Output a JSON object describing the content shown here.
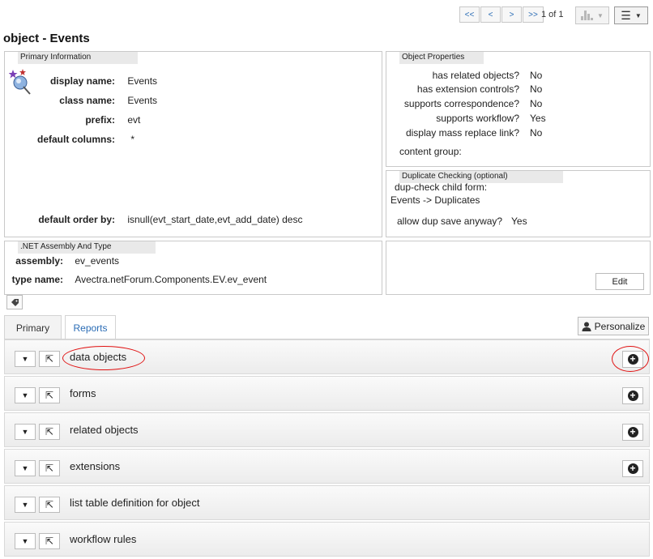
{
  "pager": {
    "first": "<<",
    "prev": "<",
    "next": ">",
    "last": ">>",
    "count": "1 of 1"
  },
  "page_title": "object - Events",
  "primary_info": {
    "title": "Primary Information",
    "rows": [
      {
        "label": "display name:",
        "value": "Events"
      },
      {
        "label": "class name:",
        "value": "Events"
      },
      {
        "label": "prefix:",
        "value": "evt"
      },
      {
        "label": "default columns:",
        "value": "*"
      }
    ],
    "default_order_label": "default order by:",
    "default_order_value": "isnull(evt_start_date,evt_add_date) desc"
  },
  "object_properties": {
    "title": "Object Properties",
    "rows": [
      {
        "label": "has related objects?",
        "value": "No"
      },
      {
        "label": "has extension controls?",
        "value": "No"
      },
      {
        "label": "supports correspondence?",
        "value": "No"
      },
      {
        "label": "supports workflow?",
        "value": "Yes"
      },
      {
        "label": "display mass replace link?",
        "value": "No"
      }
    ],
    "content_group_label": "content group:"
  },
  "dup_checking": {
    "title": "Duplicate Checking (optional)",
    "child_form_label": "dup-check child form:",
    "child_form_value": "Events -> Duplicates",
    "allow_label": "allow dup save anyway?",
    "allow_value": "Yes"
  },
  "assembly": {
    "title": ".NET Assembly And Type",
    "assembly_label": "assembly:",
    "assembly_value": "ev_events",
    "type_label": "type name:",
    "type_value": "Avectra.netForum.Components.EV.ev_event"
  },
  "edit_label": "Edit",
  "tabs": {
    "primary": "Primary",
    "reports": "Reports"
  },
  "personalize_label": "Personalize",
  "sections": [
    {
      "title": "data objects",
      "has_add": true
    },
    {
      "title": "forms",
      "has_add": true
    },
    {
      "title": "related objects",
      "has_add": true
    },
    {
      "title": "extensions",
      "has_add": true
    },
    {
      "title": "list table definition for object",
      "has_add": false
    },
    {
      "title": "workflow rules",
      "has_add": false
    }
  ],
  "colors": {
    "link": "#2a6cb5",
    "annotation": "#e01010"
  }
}
